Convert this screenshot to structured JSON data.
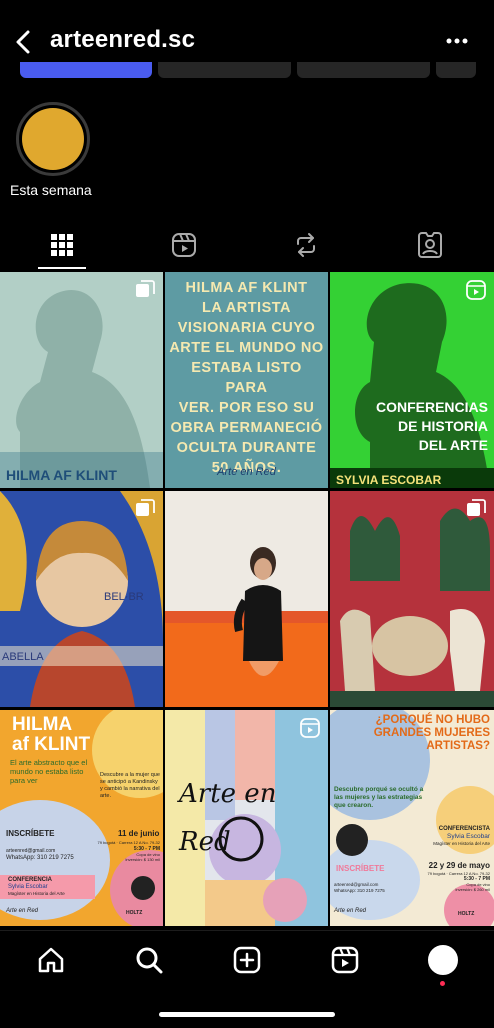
{
  "header": {
    "username": "arteenred.sc"
  },
  "colors": {
    "accent": "#4a5cf0",
    "background": "#000000",
    "notification_dot": "#ff2d55",
    "highlight_fill": "#e0a82e"
  },
  "highlights": [
    {
      "label": "Esta semana",
      "icon": "highlight-cover"
    }
  ],
  "tabs": [
    {
      "name": "grid",
      "icon": "grid-icon",
      "active": true
    },
    {
      "name": "reels",
      "icon": "reels-icon",
      "active": false
    },
    {
      "name": "reposts",
      "icon": "repost-icon",
      "active": false
    },
    {
      "name": "tagged",
      "icon": "tagged-icon",
      "active": false
    }
  ],
  "posts": {
    "p1": {
      "text": "HILMA AF KLINT",
      "badge": "carousel-icon"
    },
    "p2": {
      "text": "HILMA AF KLINT\nLA ARTISTA\nVISIONARIA CUYO\nARTE EL MUNDO NO\nESTABA LISTO PARA\nVER. POR ESO SU\nOBRA PERMANECIÓ\nOCULTA DURANTE\n50 AÑOS.",
      "signature": "Arte en Red"
    },
    "p3": {
      "title": "CONFERENCIAS\nDE HISTORIA\nDEL ARTE",
      "footer": "SYLVIA ESCOBAR",
      "badge": "reels-icon"
    },
    "p4": {
      "text": "ABELLA",
      "text2": "BEL·BR",
      "badge": "carousel-icon"
    },
    "p5": {},
    "p6": {
      "badge": "carousel-icon"
    },
    "p7": {
      "title1": "HILMA",
      "title2": "af KLINT",
      "subtitle": "El arte abstracto que el mundo no estaba listo para ver",
      "desc": "Descubre a la mujer que se anticipó a Kandinsky y cambió la narrativa del arte.",
      "cta": "INSCRÍBETE",
      "date": "11 de junio",
      "contact1": "arteenred@gmail.com",
      "contact2": "WhatsApp: 310 219 7275",
      "location": "79 bogotá · Carrera 12 A No. 79-32",
      "time": "5:30 - 7 PM",
      "venue": "Copa de vino",
      "price": "Inversión: $ 130 mil",
      "conf_label": "CONFERENCIA",
      "speaker": "Sylvia Escobar",
      "speaker_title": "Magíster en Historia del Arte",
      "brand": "Arte en Red",
      "partner": "HOLTZ"
    },
    "p8": {
      "text": "Arte en\nRed",
      "badge": "reels-icon"
    },
    "p9": {
      "title": "¿PORQUÉ NO HUBO GRANDES MUJERES ARTISTAS?",
      "desc": "Descubre porqué se ocultó a las mujeres y las estrategias que crearon.",
      "conf_label": "CONFERENCISTA",
      "speaker": "Sylvia Escobar",
      "speaker_title": "Magíster en Historia del Arte",
      "cta": "INSCRÍBETE",
      "date": "22 y 29 de mayo",
      "location": "79 bogotá · Carrera 12 A No. 79-32",
      "time": "5:30 - 7 PM",
      "venue": "Copa de vino",
      "price": "Inversión: $ 260 mil",
      "contact1": "arteenred@gmail.com",
      "contact2": "WhatsApp: 310 219 7275",
      "brand": "Arte en Red",
      "partner": "HOLTZ"
    }
  },
  "nav": [
    {
      "name": "home",
      "icon": "home-icon"
    },
    {
      "name": "search",
      "icon": "search-icon"
    },
    {
      "name": "create",
      "icon": "create-icon"
    },
    {
      "name": "reels",
      "icon": "reels-icon"
    },
    {
      "name": "profile",
      "icon": "profile-avatar"
    }
  ]
}
